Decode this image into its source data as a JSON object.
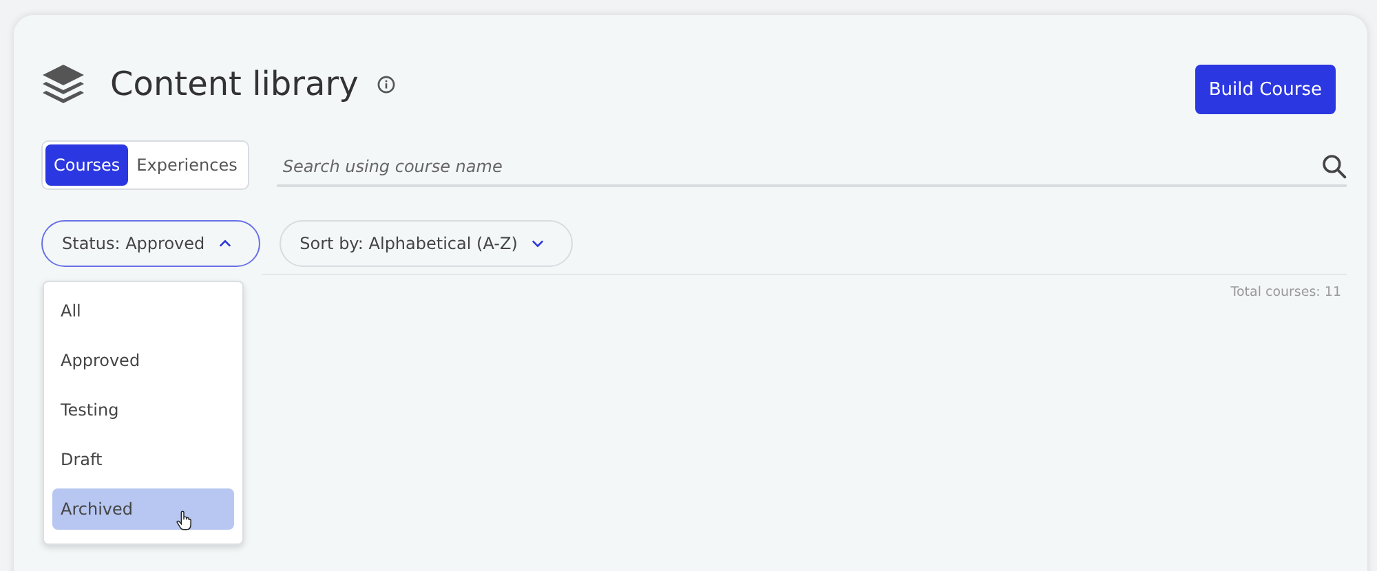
{
  "header": {
    "title": "Content library",
    "action": "Build Course"
  },
  "tabs": [
    {
      "label": "Courses",
      "selected": true
    },
    {
      "label": "Experiences",
      "selected": false
    }
  ],
  "search": {
    "placeholder": "Search using course name"
  },
  "filters": [
    {
      "label": "Status: Approved",
      "expanded": true
    },
    {
      "label": "Sort by: Alphabetical (A-Z)",
      "expanded": false
    }
  ],
  "total": "Total courses: 11",
  "status_menu": [
    {
      "label": "All",
      "highlighted": false
    },
    {
      "label": "Approved",
      "highlighted": false
    },
    {
      "label": "Testing",
      "highlighted": false
    },
    {
      "label": "Draft",
      "highlighted": false
    },
    {
      "label": "Archived",
      "highlighted": true
    }
  ]
}
